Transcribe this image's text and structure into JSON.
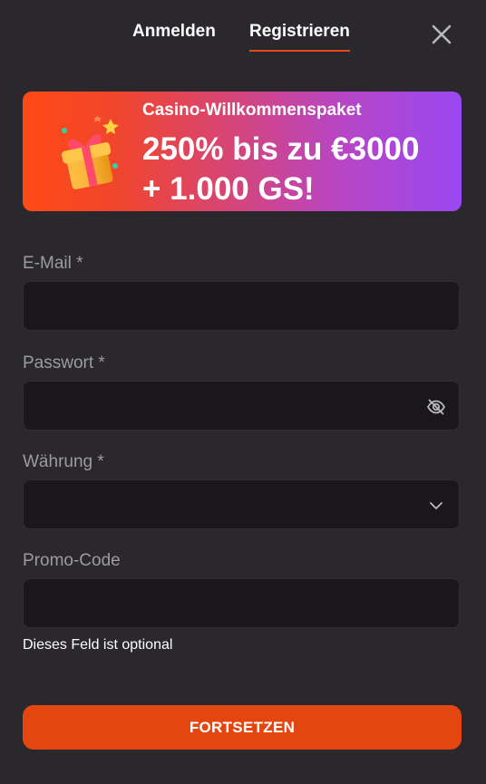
{
  "tabs": {
    "login": "Anmelden",
    "register": "Registrieren",
    "active": "register"
  },
  "banner": {
    "subtitle": "Casino-Willkommenspaket",
    "headline_line1": "250% bis zu €3000",
    "headline_line2": "+ 1.000 GS!",
    "gradient": [
      "#ff4a14",
      "#d94570",
      "#9a48f2"
    ]
  },
  "form": {
    "email": {
      "label": "E-Mail *",
      "value": "",
      "placeholder": ""
    },
    "password": {
      "label": "Passwort *",
      "value": "",
      "placeholder": "",
      "toggle_icon": "eye-off-icon"
    },
    "currency": {
      "label": "Währung *",
      "selected": "",
      "dropdown_icon": "chevron-down-icon"
    },
    "promo": {
      "label": "Promo-Code",
      "value": "",
      "placeholder": "",
      "hint": "Dieses Feld ist optional"
    }
  },
  "submit_label": "FORTSETZEN",
  "colors": {
    "accent": "#e3460f",
    "background": "#2a282c",
    "field_bg": "#19171b",
    "label": "#9c9ba0"
  }
}
